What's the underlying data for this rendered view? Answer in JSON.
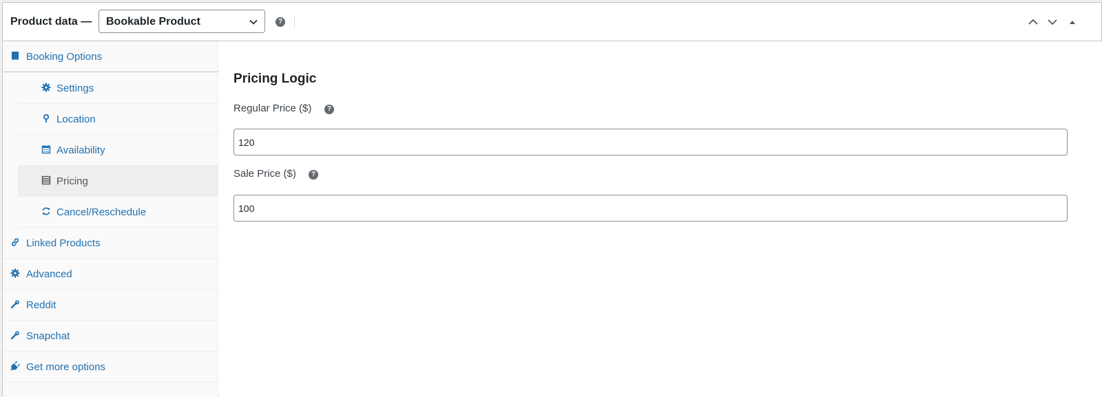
{
  "header": {
    "title": "Product data —",
    "product_type": "Bookable Product",
    "help": "?"
  },
  "sidebar": {
    "items": [
      {
        "label": "Booking Options",
        "icon": "book-icon"
      },
      {
        "label": "Settings",
        "icon": "gear-icon"
      },
      {
        "label": "Location",
        "icon": "location-pin-icon"
      },
      {
        "label": "Availability",
        "icon": "calendar-icon"
      },
      {
        "label": "Pricing",
        "icon": "list-icon",
        "active": true
      },
      {
        "label": "Cancel/Reschedule",
        "icon": "refresh-icon"
      },
      {
        "label": "Linked Products",
        "icon": "link-icon"
      },
      {
        "label": "Advanced",
        "icon": "gear-icon"
      },
      {
        "label": "Reddit",
        "icon": "wrench-icon"
      },
      {
        "label": "Snapchat",
        "icon": "wrench-icon"
      },
      {
        "label": "Get more options",
        "icon": "plugin-icon"
      }
    ]
  },
  "main": {
    "section_title": "Pricing Logic",
    "regular_price": {
      "label": "Regular Price ($)",
      "value": "120",
      "help": "?"
    },
    "sale_price": {
      "label": "Sale Price ($)",
      "value": "100",
      "help": "?"
    }
  },
  "colors": {
    "link": "#2271b1",
    "active_bg": "#eeeeee",
    "border": "#c3c4c7"
  }
}
